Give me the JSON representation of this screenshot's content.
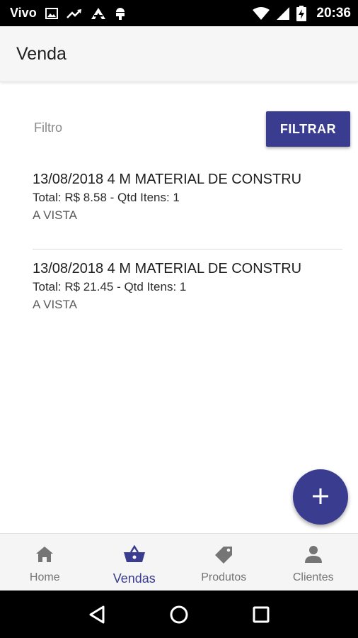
{
  "status_bar": {
    "carrier": "Vivo",
    "time": "20:36",
    "icons": [
      "image-icon",
      "trending-up-icon",
      "android-studio-icon",
      "android-icon",
      "wifi-icon",
      "signal-icon",
      "battery-charging-icon"
    ]
  },
  "app_bar": {
    "title": "Venda"
  },
  "filter": {
    "placeholder": "Filtro",
    "value": "",
    "button_label": "FILTRAR"
  },
  "sales": [
    {
      "title": "13/08/2018 4 M MATERIAL DE CONSTRU",
      "summary": "Total: R$ 8.58 - Qtd Itens: 1",
      "payment": "A VISTA"
    },
    {
      "title": "13/08/2018 4 M MATERIAL DE CONSTRU",
      "summary": "Total: R$ 21.45 - Qtd Itens: 1",
      "payment": "A VISTA"
    }
  ],
  "fab": {
    "icon": "plus-icon"
  },
  "bottom_nav": {
    "active": "Vendas",
    "items": [
      {
        "label": "Home",
        "icon": "home-icon"
      },
      {
        "label": "Vendas",
        "icon": "shopping-basket-icon"
      },
      {
        "label": "Produtos",
        "icon": "tag-icon"
      },
      {
        "label": "Clientes",
        "icon": "person-icon"
      }
    ]
  },
  "colors": {
    "primary": "#3a3d8f",
    "inactive": "#757575",
    "app_bar_bg": "#f6f6f6"
  }
}
